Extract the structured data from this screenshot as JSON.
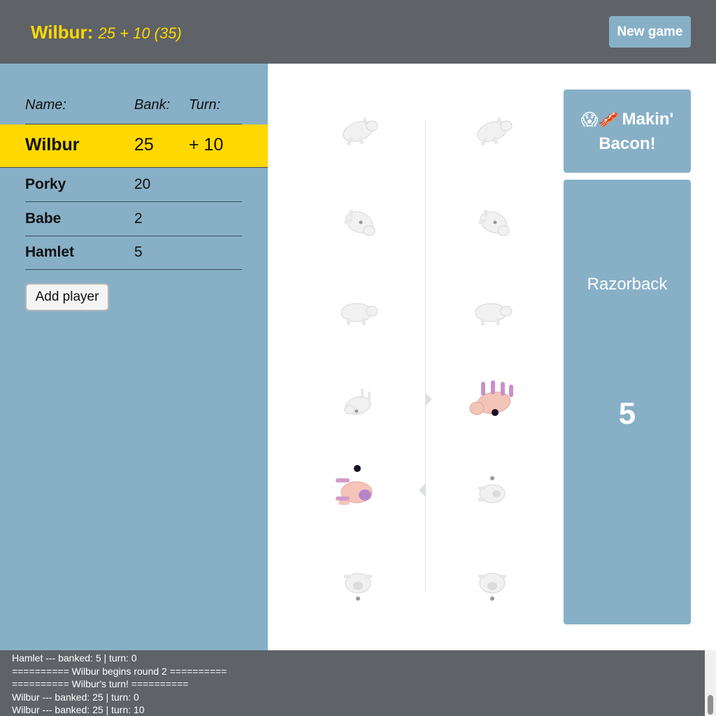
{
  "header": {
    "current_player": "Wilbur:",
    "score_summary": "25 + 10 (35)",
    "new_game_label": "New game"
  },
  "scoreboard": {
    "col_name": "Name:",
    "col_bank": "Bank:",
    "col_turn": "Turn:",
    "players": [
      {
        "name": "Wilbur",
        "bank": "25",
        "turn": "+ 10",
        "active": true
      },
      {
        "name": "Porky",
        "bank": "20",
        "turn": "",
        "active": false
      },
      {
        "name": "Babe",
        "bank": "2",
        "turn": "",
        "active": false
      },
      {
        "name": "Hamlet",
        "bank": "5",
        "turn": "",
        "active": false
      }
    ],
    "add_player_label": "Add player"
  },
  "pig_options": {
    "left": [
      "razorback",
      "trotter",
      "snouter",
      "leaning-jowler",
      "dot-side",
      "no-dot-side"
    ],
    "right": [
      "razorback",
      "trotter",
      "snouter",
      "leaning-jowler",
      "dot-side",
      "no-dot-side"
    ],
    "selected": {
      "left": "dot-side",
      "right": "leaning-jowler"
    }
  },
  "bacon_button": {
    "emoji": "😱🥓",
    "label_line1": "Makin'",
    "label_line2": "Bacon!"
  },
  "roll": {
    "name": "Razorback",
    "score": "5"
  },
  "colors": {
    "accent": "#ffd800",
    "panel": "#87b0c7",
    "dark": "#5f6267"
  },
  "log": [
    "Hamlet --- banked: 5 | turn: 0",
    "========== Wilbur begins round 2 ==========",
    "========== Wilbur's turn! ==========",
    "Wilbur --- banked: 25 | turn: 0",
    "Wilbur --- banked: 25 | turn: 10"
  ]
}
